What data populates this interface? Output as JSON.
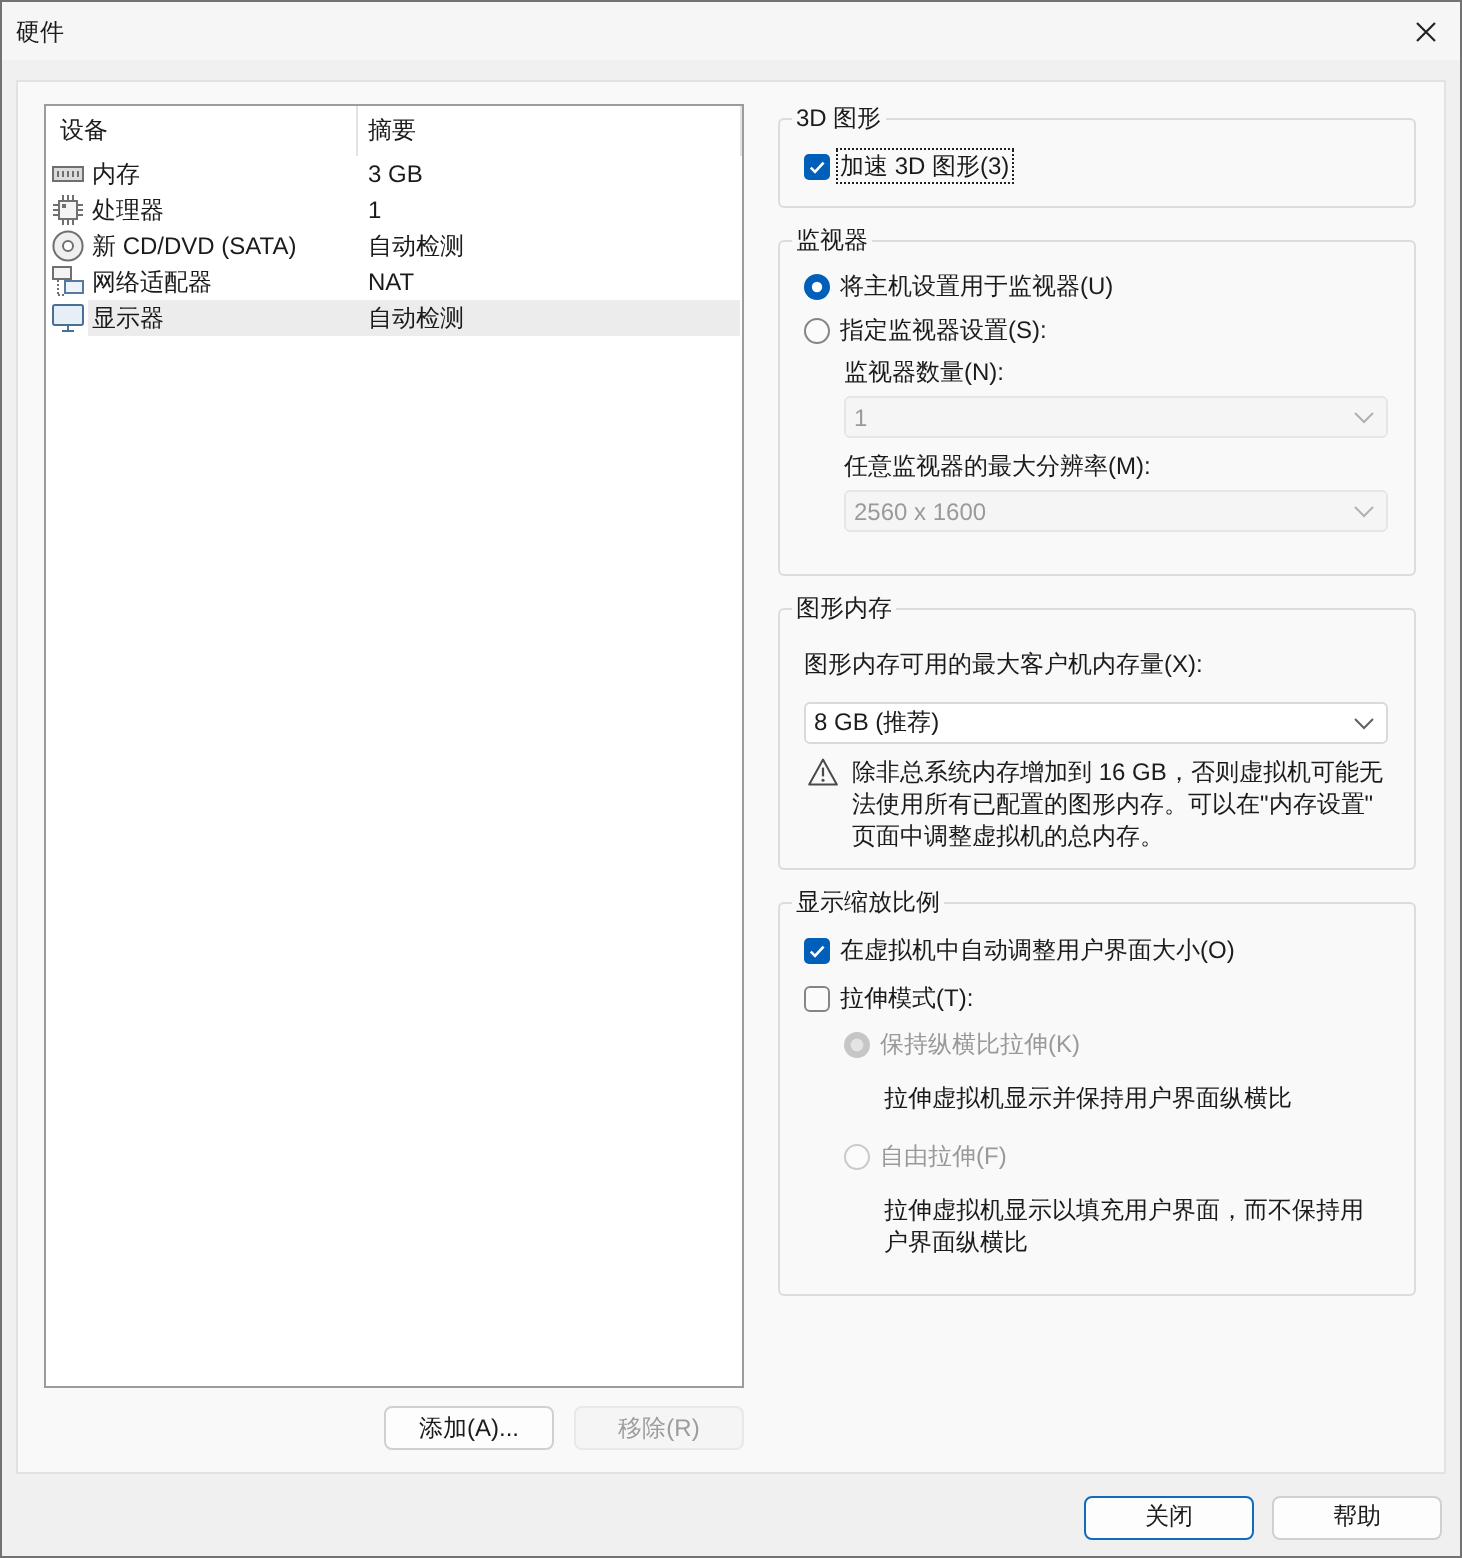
{
  "window": {
    "title": "硬件"
  },
  "device_list": {
    "columns": [
      "设备",
      "摘要"
    ],
    "rows": [
      {
        "kind": "memory",
        "device": "内存",
        "summary": "3 GB",
        "selected": false
      },
      {
        "kind": "processor",
        "device": "处理器",
        "summary": "1",
        "selected": false
      },
      {
        "kind": "cd_drive",
        "device": "新 CD/DVD (SATA)",
        "summary": "自动检测",
        "selected": false
      },
      {
        "kind": "network",
        "device": "网络适配器",
        "summary": "NAT",
        "selected": false
      },
      {
        "kind": "display",
        "device": "显示器",
        "summary": "自动检测",
        "selected": true
      }
    ]
  },
  "list_buttons": [
    {
      "label": "添加(A)...",
      "disabled": false
    },
    {
      "label": "移除(R)",
      "disabled": true
    }
  ],
  "groups": [
    {
      "title": "3D 图形",
      "items": [
        {
          "kind": "checkbox",
          "label": "加速 3D 图形(3)",
          "checked": true,
          "disabled": false,
          "focused": true
        }
      ]
    },
    {
      "title": "监视器",
      "items": [
        {
          "kind": "radio",
          "label": "将主机设置用于监视器(U)",
          "selected": true,
          "disabled": false,
          "focused": false
        },
        {
          "kind": "radio",
          "label": "指定监视器设置(S):",
          "selected": false,
          "disabled": false,
          "focused": false,
          "children": [
            {
              "kind": "select",
              "label": "监视器数量(N):",
              "value": "1",
              "disabled": true
            },
            {
              "kind": "select",
              "label": "任意监视器的最大分辨率(M):",
              "value": "2560 x 1600",
              "disabled": true
            }
          ]
        }
      ]
    },
    {
      "title": "图形内存",
      "items": [
        {
          "kind": "select",
          "label": "图形内存可用的最大客户机内存量(X):",
          "value": "8 GB (推荐)",
          "disabled": false
        },
        {
          "kind": "warning",
          "text": "除非总系统内存增加到 16 GB，否则虚拟机可能无法使用所有已配置的图形内存。可以在\"内存设置\"页面中调整虚拟机的总内存。"
        }
      ]
    },
    {
      "title": "显示缩放比例",
      "items": [
        {
          "kind": "checkbox",
          "label": "在虚拟机中自动调整用户界面大小(O)",
          "checked": true,
          "disabled": false,
          "focused": false
        },
        {
          "kind": "checkbox",
          "label": "拉伸模式(T):",
          "checked": false,
          "disabled": false,
          "focused": false,
          "children": [
            {
              "kind": "radio",
              "label": "保持纵横比拉伸(K)",
              "selected": true,
              "disabled": true,
              "focused": false,
              "children": [
                {
                  "kind": "description",
                  "text": "拉伸虚拟机显示并保持用户界面纵横比"
                }
              ]
            },
            {
              "kind": "radio",
              "label": "自由拉伸(F)",
              "selected": false,
              "disabled": true,
              "focused": false,
              "children": [
                {
                  "kind": "description",
                  "text": "拉伸虚拟机显示以填充用户界面，而不保持用户界面纵横比"
                }
              ]
            }
          ]
        }
      ]
    }
  ],
  "footer_buttons": [
    {
      "label": "关闭",
      "default": true
    },
    {
      "label": "帮助",
      "default": false
    }
  ]
}
